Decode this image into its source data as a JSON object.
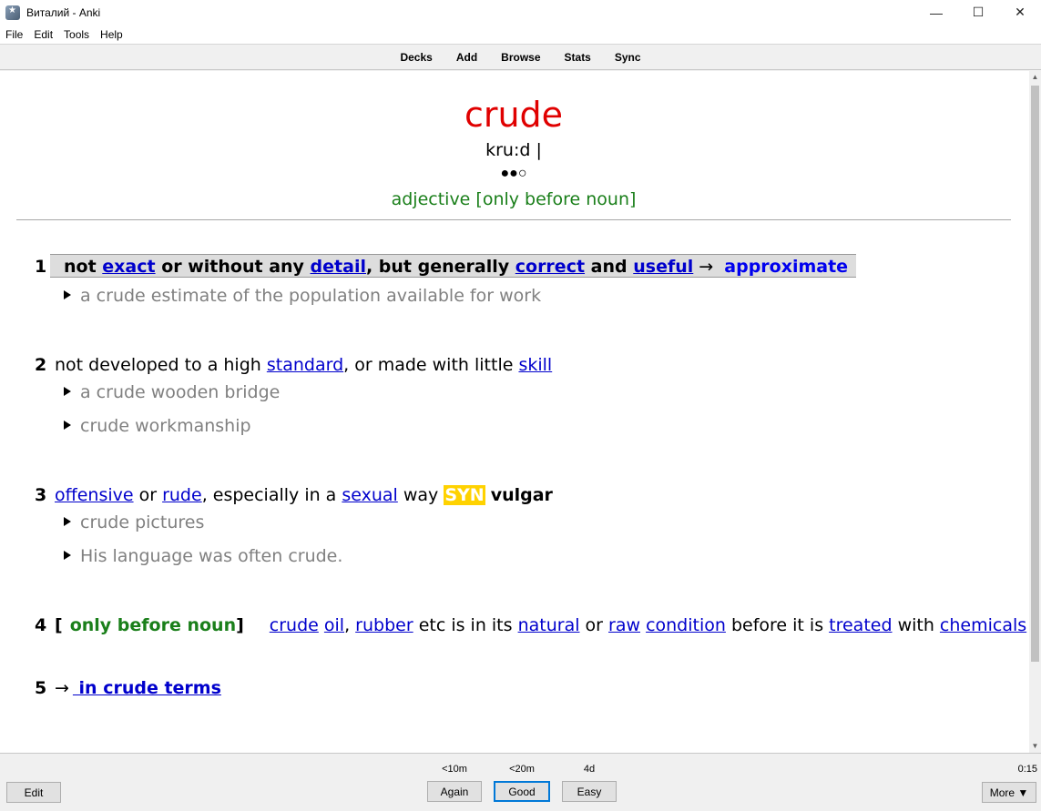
{
  "window": {
    "title": "Виталий - Anki",
    "minimize_glyph": "—",
    "maximize_glyph": "☐",
    "close_glyph": "✕"
  },
  "menu": [
    "File",
    "Edit",
    "Tools",
    "Help"
  ],
  "toolbar": [
    "Decks",
    "Add",
    "Browse",
    "Stats",
    "Sync"
  ],
  "card": {
    "word": "crude",
    "pronunciation": "kru:d |",
    "frequency": "●●○",
    "part_of_speech": "adjective [only before noun]",
    "senses": {
      "s1": {
        "num": "1",
        "t1": "not ",
        "l1": "exact",
        "t2": " or without any ",
        "l2": "detail",
        "t3": ", but generally ",
        "l3": "correct",
        "t4": " and ",
        "l4": "useful",
        "arrow": " → ",
        "ref": "approximate",
        "ex1": "a crude estimate of the population available for work"
      },
      "s2": {
        "num": "2",
        "t1": "not developed to a high ",
        "l1": "standard",
        "t2": ", or made with little ",
        "l2": "skill",
        "ex1": "a crude wooden bridge",
        "ex2": "crude workmanship"
      },
      "s3": {
        "num": "3",
        "l1": "offensive",
        "t1": " or ",
        "l2": "rude",
        "t2": ", especially in a ",
        "l3": "sexual",
        "t3": " way ",
        "syn_label": "SYN",
        "syn_word": "vulgar",
        "ex1": "crude pictures",
        "ex2": "His language was often crude."
      },
      "s4": {
        "num": "4",
        "bracket_open": "[",
        "grammar": "only before noun",
        "bracket_close": "]",
        "l1": "crude",
        "l2": "oil",
        "t1": ", ",
        "l3": "rubber",
        "t2": " etc is in its ",
        "l4": "natural",
        "t3": " or ",
        "l5": "raw",
        "l6": "condition",
        "t4": " before it is ",
        "l7": "treated",
        "t5": " with ",
        "l8": "chemicals"
      },
      "s5": {
        "num": "5",
        "arrow": "→",
        "phrase": " in crude terms"
      }
    }
  },
  "bottom": {
    "edit": "Edit",
    "answers": [
      {
        "interval": "<10m",
        "label": "Again"
      },
      {
        "interval": "<20m",
        "label": "Good"
      },
      {
        "interval": "4d",
        "label": "Easy"
      }
    ],
    "timer": "0:15",
    "more": "More ▼"
  }
}
